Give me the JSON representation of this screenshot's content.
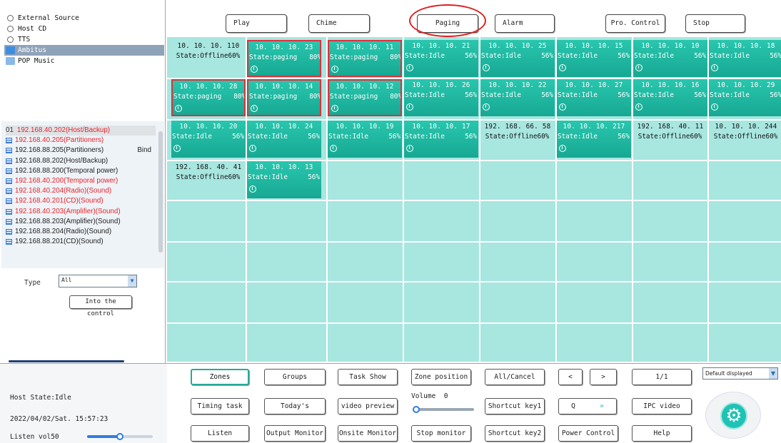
{
  "sources": [
    {
      "label": "External Source",
      "icon": "disc-icon"
    },
    {
      "label": "Host CD",
      "icon": "disc-icon"
    },
    {
      "label": "TTS",
      "icon": "disc-icon"
    },
    {
      "label": "Ambitus",
      "icon": "folder-icon"
    },
    {
      "label": "POP Music",
      "icon": "music-folder-icon"
    }
  ],
  "devices": [
    {
      "num": "01",
      "label": "192.168.40.202(Host/Backup)",
      "color": "#e8232b"
    },
    {
      "label": "192.168.40.205(Partitioners)",
      "color": "#e8232b"
    },
    {
      "label": "192.168.88.205(Partitioners)",
      "color": "#222222",
      "bind": "Bind"
    },
    {
      "label": "192.168.88.202(Host/Backup)",
      "color": "#222222"
    },
    {
      "label": "192.168.88.200(Temporal power)",
      "color": "#222222"
    },
    {
      "label": "192.168.40.200(Temporal power)",
      "color": "#e8232b"
    },
    {
      "label": "192.168.40.204(Radio)(Sound)",
      "color": "#e8232b"
    },
    {
      "label": "192.168.40.201(CD)(Sound)",
      "color": "#e8232b"
    },
    {
      "label": "192.168.40.203(Amplifier)(Sound)",
      "color": "#e8232b"
    },
    {
      "label": "192.168.88.203(Amplifier)(Sound)",
      "color": "#222222"
    },
    {
      "label": "192.168.88.204(Radio)(Sound)",
      "color": "#222222"
    },
    {
      "label": "192.168.88.201(CD)(Sound)",
      "color": "#222222"
    }
  ],
  "type_filter": {
    "label": "Type",
    "value": "All"
  },
  "into_control_label": "Into the control",
  "host": {
    "state_label": "Host State:",
    "state_value": "Idle",
    "datetime": "2022/04/02/Sat.  15:57:23",
    "listen_label": "Listen vol50",
    "listen_level": 0.5
  },
  "top_buttons": {
    "play": "Play",
    "chime": "Chime",
    "paging": "Paging",
    "alarm": "Alarm",
    "pro_control": "Pro. Control",
    "stop": "Stop"
  },
  "zones": [
    {
      "ip": "10. 10. 10. 110",
      "state": "State:Offline",
      "vol": "60%",
      "status": "offline"
    },
    {
      "ip": "10. 10. 10. 23",
      "state": "State:paging",
      "vol": "80%",
      "status": "paging"
    },
    {
      "ip": "10. 10. 10. 11",
      "state": "State:paging",
      "vol": "80%",
      "status": "paging"
    },
    {
      "ip": "10. 10. 10. 21",
      "state": "State:Idle",
      "vol": "56%",
      "status": "idle"
    },
    {
      "ip": "10. 10. 10. 25",
      "state": "State:Idle",
      "vol": "56%",
      "status": "idle"
    },
    {
      "ip": "10. 10. 10. 15",
      "state": "State:Idle",
      "vol": "56%",
      "status": "idle"
    },
    {
      "ip": "10. 10. 10. 10",
      "state": "State:Idle",
      "vol": "56%",
      "status": "idle"
    },
    {
      "ip": "10. 10. 10. 18",
      "state": "State:Idle",
      "vol": "56%",
      "status": "idle"
    },
    {
      "ip": "10. 10. 10. 28",
      "state": "State:paging",
      "vol": "80%",
      "status": "paging"
    },
    {
      "ip": "10. 10. 10. 14",
      "state": "State:paging",
      "vol": "80%",
      "status": "paging"
    },
    {
      "ip": "10. 10. 10. 12",
      "state": "State:paging",
      "vol": "80%",
      "status": "paging"
    },
    {
      "ip": "10. 10. 10. 26",
      "state": "State:Idle",
      "vol": "56%",
      "status": "idle"
    },
    {
      "ip": "10. 10. 10. 22",
      "state": "State:Idle",
      "vol": "56%",
      "status": "idle"
    },
    {
      "ip": "10. 10. 10. 27",
      "state": "State:Idle",
      "vol": "56%",
      "status": "idle"
    },
    {
      "ip": "10. 10. 10. 16",
      "state": "State:Idle",
      "vol": "56%",
      "status": "idle"
    },
    {
      "ip": "10. 10. 10. 29",
      "state": "State:Idle",
      "vol": "56%",
      "status": "idle"
    },
    {
      "ip": "10. 10. 10. 20",
      "state": "State:Idle",
      "vol": "56%",
      "status": "idle"
    },
    {
      "ip": "10. 10. 10. 24",
      "state": "State:Idle",
      "vol": "56%",
      "status": "idle"
    },
    {
      "ip": "10. 10. 10. 19",
      "state": "State:Idle",
      "vol": "56%",
      "status": "idle"
    },
    {
      "ip": "10. 10. 10. 17",
      "state": "State:Idle",
      "vol": "56%",
      "status": "idle"
    },
    {
      "ip": "192. 168. 66. 58",
      "state": "State:Offline",
      "vol": "60%",
      "status": "offline"
    },
    {
      "ip": "10. 10. 10. 217",
      "state": "State:Idle",
      "vol": "56%",
      "status": "idle"
    },
    {
      "ip": "192. 168. 40. 11",
      "state": "State:Offline",
      "vol": "60%",
      "status": "offline"
    },
    {
      "ip": "10. 10. 10. 244",
      "state": "State:Offline",
      "vol": "60%",
      "status": "offline"
    },
    {
      "ip": "192. 168. 40. 41",
      "state": "State:Offline",
      "vol": "60%",
      "status": "offline"
    },
    {
      "ip": "10. 10. 10. 13",
      "state": "State:Idle",
      "vol": "56%",
      "status": "idle"
    }
  ],
  "bottom_buttons": {
    "zones": "Zones",
    "groups": "Groups",
    "task_show": "Task Show",
    "zone_position": "Zone  position",
    "all_cancel": "All/Cancel",
    "prev": "<",
    "next": ">",
    "page": "1/1",
    "timing_task": "Timing task",
    "todays": "Today's",
    "video_preview": "video preview",
    "shortcut_key1": "Shortcut key1",
    "search_icon_glyph": "Q",
    "fast_forward_glyph": "»",
    "ipc_video": "IPC video",
    "listen": "Listen",
    "output_monitor": "Output Monitor",
    "onsite_monitor": "Onsite Monitor",
    "stop_monitor": "Stop monitor",
    "shortcut_key2": "Shortcut key2",
    "power_control": "Power Control",
    "help": "Help"
  },
  "volume": {
    "label": "Volume",
    "value": "0",
    "level": 0.0
  },
  "display_select": {
    "value": "Default displayed"
  },
  "colors": {
    "tile_online": "#1fb59e",
    "grid_bg": "#a8e6e0",
    "paging_border": "#e0303a",
    "device_red": "#e8232b",
    "accent_blue": "#2f7de0"
  },
  "gear_glyph": "⚙"
}
